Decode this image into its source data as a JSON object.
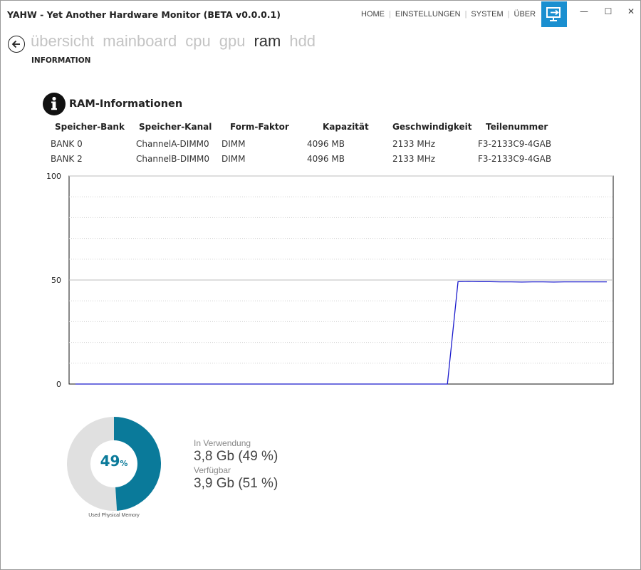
{
  "window": {
    "title": "YAHW - Yet Another Hardware Monitor (BETA v0.0.0.1)",
    "minimize_glyph": "—",
    "maximize_glyph": "☐",
    "close_glyph": "✕"
  },
  "topnav": {
    "items": [
      "HOME",
      "EINSTELLUNGEN",
      "SYSTEM",
      "ÜBER"
    ],
    "separator": "|",
    "monitor_icon": "monitor-arrow-icon",
    "accent": "#1a8fd0"
  },
  "sections": {
    "tabs": [
      "übersicht",
      "mainboard",
      "cpu",
      "gpu",
      "ram",
      "hdd"
    ],
    "active": "ram",
    "subtitle": "INFORMATION"
  },
  "ram_info": {
    "icon_letter": "i",
    "heading": "RAM-Informationen",
    "columns": [
      "Speicher-Bank",
      "Speicher-Kanal",
      "Form-Faktor",
      "Kapazität",
      "Geschwindigkeit",
      "Teilenummer"
    ],
    "rows": [
      [
        "BANK 0",
        "ChannelA-DIMM0",
        "DIMM",
        "4096 MB",
        "2133 MHz",
        "F3-2133C9-4GAB"
      ],
      [
        "BANK 2",
        "ChannelB-DIMM0",
        "DIMM",
        "4096 MB",
        "2133 MHz",
        "F3-2133C9-4GAB"
      ]
    ]
  },
  "chart_data": {
    "type": "line",
    "ylim": [
      0,
      100
    ],
    "y_ticks": [
      0,
      50,
      100
    ],
    "grid": true,
    "series": [
      {
        "color": "#1a1acc",
        "values": [
          0,
          0,
          0,
          0,
          0,
          0,
          0,
          0,
          0,
          0,
          0,
          0,
          0,
          0,
          0,
          0,
          0,
          0,
          0,
          0,
          0,
          0,
          0,
          0,
          0,
          0,
          0,
          0,
          0,
          0,
          0,
          0,
          0,
          0,
          0,
          0,
          49.2,
          49.3,
          49.2,
          49.2,
          49.1,
          49.1,
          49.0,
          49.1,
          49.1,
          49.0,
          49.1,
          49.1,
          49.1,
          49.1,
          49.1
        ]
      }
    ]
  },
  "memory": {
    "percent_used": 49,
    "percent_value": "49",
    "percent_sign": "%",
    "caption": "Used Physical Memory",
    "used_color": "#0a7a9a",
    "free_color": "#e0e0e0",
    "in_use_label": "In Verwendung",
    "in_use_value": "3,8 Gb (49 %)",
    "available_label": "Verfügbar",
    "available_value": "3,9 Gb (51 %)"
  }
}
